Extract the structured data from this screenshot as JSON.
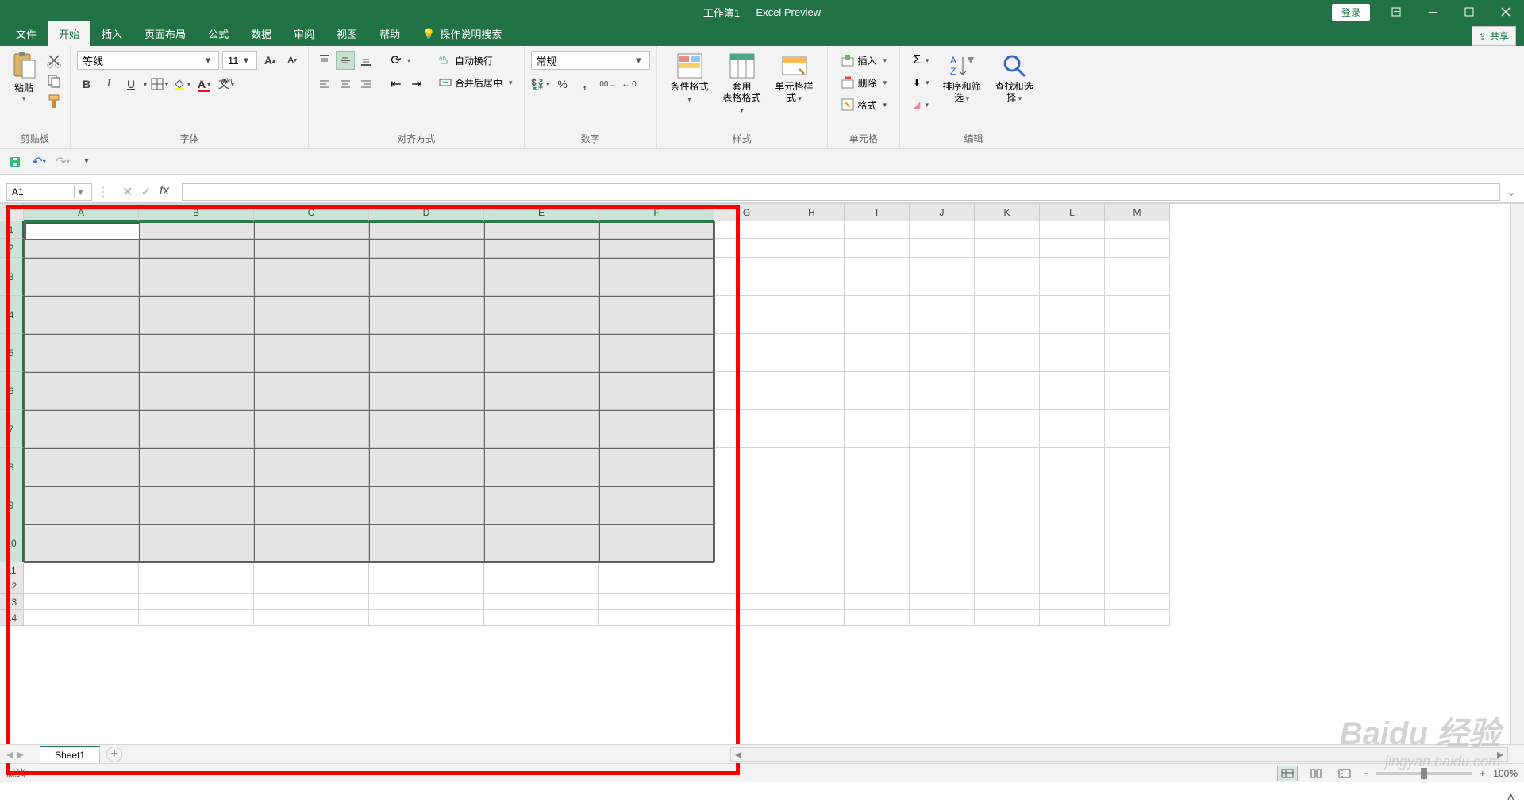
{
  "title": {
    "doc": "工作簿1",
    "app": "Excel Preview",
    "login": "登录"
  },
  "tabs": {
    "file": "文件",
    "home": "开始",
    "insert": "插入",
    "layout": "页面布局",
    "formulas": "公式",
    "data": "数据",
    "review": "审阅",
    "view": "视图",
    "help": "帮助",
    "tell": "操作说明搜索",
    "share": "共享"
  },
  "ribbon": {
    "clipboard": {
      "paste": "粘贴",
      "label": "剪贴板"
    },
    "font": {
      "name": "等线",
      "size": "11",
      "label": "字体",
      "phonetic": "wén"
    },
    "alignment": {
      "wrap": "自动换行",
      "merge": "合并后居中",
      "label": "对齐方式"
    },
    "number": {
      "format": "常规",
      "label": "数字"
    },
    "styles": {
      "cond": "条件格式",
      "table": "套用\n表格格式",
      "cell": "单元格样式",
      "label": "样式"
    },
    "cells": {
      "insert": "插入",
      "delete": "删除",
      "format": "格式",
      "label": "单元格"
    },
    "editing": {
      "sort": "排序和筛选",
      "find": "查找和选择",
      "label": "编辑"
    }
  },
  "name_box": "A1",
  "columns": [
    "A",
    "B",
    "C",
    "D",
    "E",
    "F",
    "G",
    "H",
    "I",
    "J",
    "K",
    "L",
    "M"
  ],
  "col_widths": {
    "sel": 145,
    "rest": 82
  },
  "rows": {
    "count": 10,
    "first_h": 22,
    "second_h": 24,
    "rest_h": 48
  },
  "selection": {
    "from": "A1",
    "to": "F10",
    "cols": 6,
    "rows": 10
  },
  "sheet_tabs": {
    "sheet1": "Sheet1"
  },
  "status": {
    "ready": "就绪",
    "zoom": "100%"
  },
  "watermark": {
    "brand": "Baidu 经验",
    "url": "jingyan.baidu.com"
  }
}
